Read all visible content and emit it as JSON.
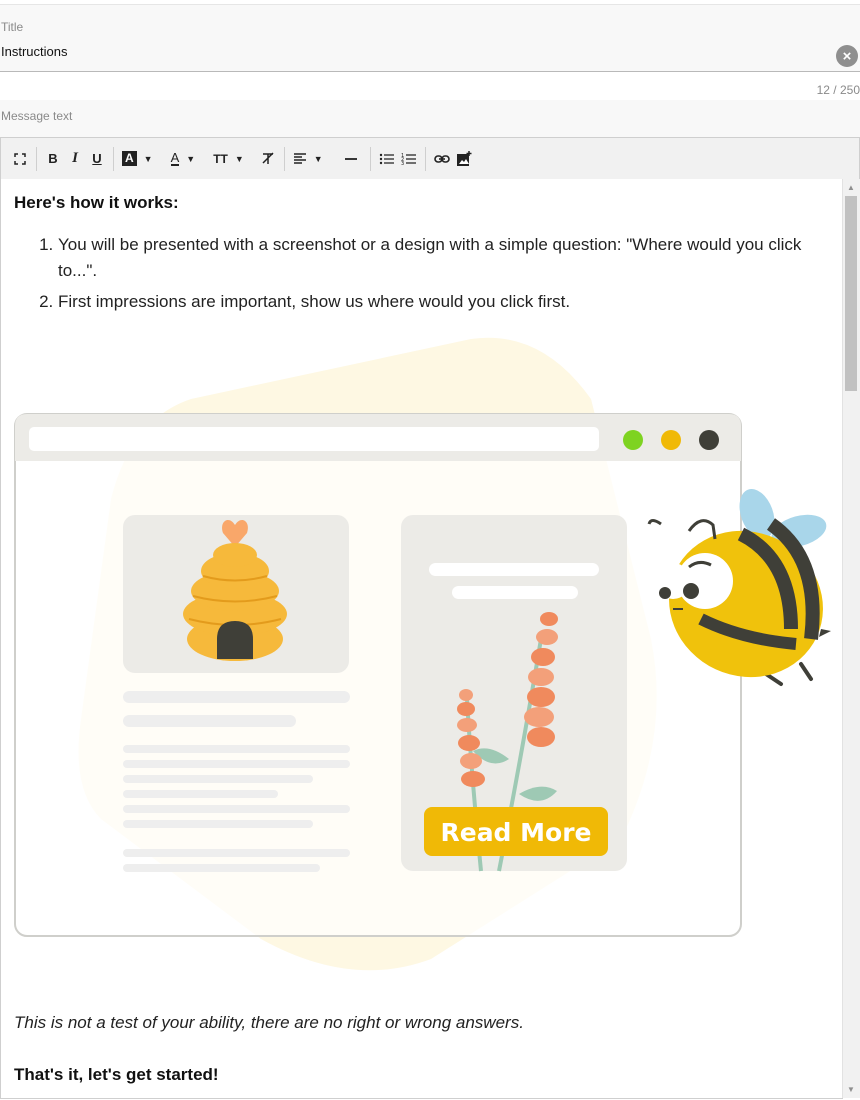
{
  "title_field": {
    "label": "Title",
    "value": "Instructions",
    "clear_icon": "close-circle-icon"
  },
  "counter": "12 / 250",
  "message_field": {
    "label": "Message text"
  },
  "toolbar": {
    "fullscreen_icon": "fullscreen-icon",
    "bold": "B",
    "italic": "I",
    "underline": "U",
    "bg_color": "A",
    "font_color": "A",
    "font_size": "TT",
    "clear_format_icon": "clear-format-icon",
    "align_icon": "align-left-icon",
    "hr_icon": "horizontal-rule-icon",
    "ul_icon": "bulleted-list-icon",
    "ol_icon": "numbered-list-icon",
    "link_icon": "link-icon",
    "image_icon": "insert-image-icon"
  },
  "content": {
    "heading": "Here's how it works:",
    "list": [
      "You will be presented with a screenshot or a design with a simple question: \"Where would you click to...\".",
      "First impressions are important, show us where would you click first."
    ],
    "illustration": {
      "button_label": "Read More"
    },
    "note": "This is not a test of your ability, there are no right or wrong answers.",
    "closing": "That's it, let's get started!"
  },
  "colors": {
    "accent_yellow": "#f0b906",
    "window_dot_green": "#7ed321",
    "window_dot_yellow": "#f0b906",
    "window_dot_dark": "#3f3f38"
  }
}
